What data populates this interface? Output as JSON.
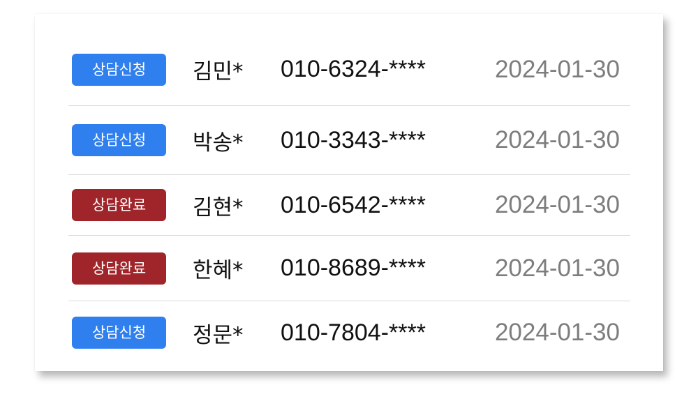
{
  "status_colors": {
    "상담신청": "#2f7fee",
    "상담완료": "#a0252a"
  },
  "rows": [
    {
      "status": "상담신청",
      "name": "김민*",
      "phone": "010-6324-****",
      "date": "2024-01-30"
    },
    {
      "status": "상담신청",
      "name": "박송*",
      "phone": "010-3343-****",
      "date": "2024-01-30"
    },
    {
      "status": "상담완료",
      "name": "김현*",
      "phone": "010-6542-****",
      "date": "2024-01-30"
    },
    {
      "status": "상담완료",
      "name": "한혜*",
      "phone": "010-8689-****",
      "date": "2024-01-30"
    },
    {
      "status": "상담신청",
      "name": "정문*",
      "phone": "010-7804-****",
      "date": "2024-01-30"
    }
  ]
}
